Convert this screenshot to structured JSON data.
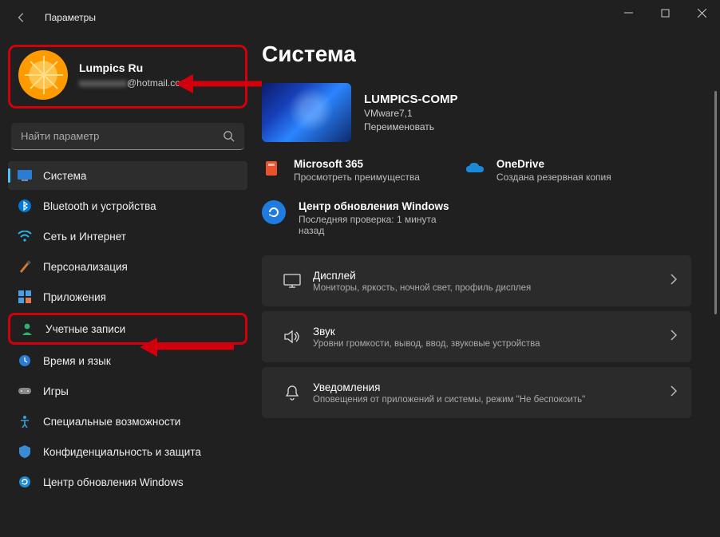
{
  "window": {
    "title": "Параметры"
  },
  "profile": {
    "name": "Lumpics Ru",
    "email_visible": "@hotmail.com",
    "email_blurred": "xxxxxxxxxx"
  },
  "search": {
    "placeholder": "Найти параметр"
  },
  "nav": {
    "items": [
      {
        "key": "system",
        "label": "Система",
        "selected": true
      },
      {
        "key": "bluetooth",
        "label": "Bluetooth и устройства"
      },
      {
        "key": "network",
        "label": "Сеть и Интернет"
      },
      {
        "key": "personalization",
        "label": "Персонализация"
      },
      {
        "key": "apps",
        "label": "Приложения"
      },
      {
        "key": "accounts",
        "label": "Учетные записи",
        "highlighted": true
      },
      {
        "key": "time",
        "label": "Время и язык"
      },
      {
        "key": "gaming",
        "label": "Игры"
      },
      {
        "key": "accessibility",
        "label": "Специальные возможности"
      },
      {
        "key": "privacy",
        "label": "Конфиденциальность и защита"
      },
      {
        "key": "update",
        "label": "Центр обновления Windows"
      }
    ]
  },
  "main": {
    "heading": "Система",
    "pc": {
      "name": "LUMPICS-COMP",
      "model": "VMware7,1",
      "rename": "Переименовать"
    },
    "promo": {
      "m365": {
        "title": "Microsoft 365",
        "sub": "Просмотреть преимущества"
      },
      "onedrive": {
        "title": "OneDrive",
        "sub": "Создана резервная копия"
      }
    },
    "update": {
      "title": "Центр обновления Windows",
      "sub": "Последняя проверка: 1 минута назад"
    },
    "cards": [
      {
        "key": "display",
        "title": "Дисплей",
        "sub": "Мониторы, яркость, ночной свет, профиль дисплея"
      },
      {
        "key": "sound",
        "title": "Звук",
        "sub": "Уровни громкости, вывод, ввод, звуковые устройства"
      },
      {
        "key": "notifications",
        "title": "Уведомления",
        "sub": "Оповещения от приложений и системы, режим \"Не беспокоить\""
      }
    ]
  }
}
